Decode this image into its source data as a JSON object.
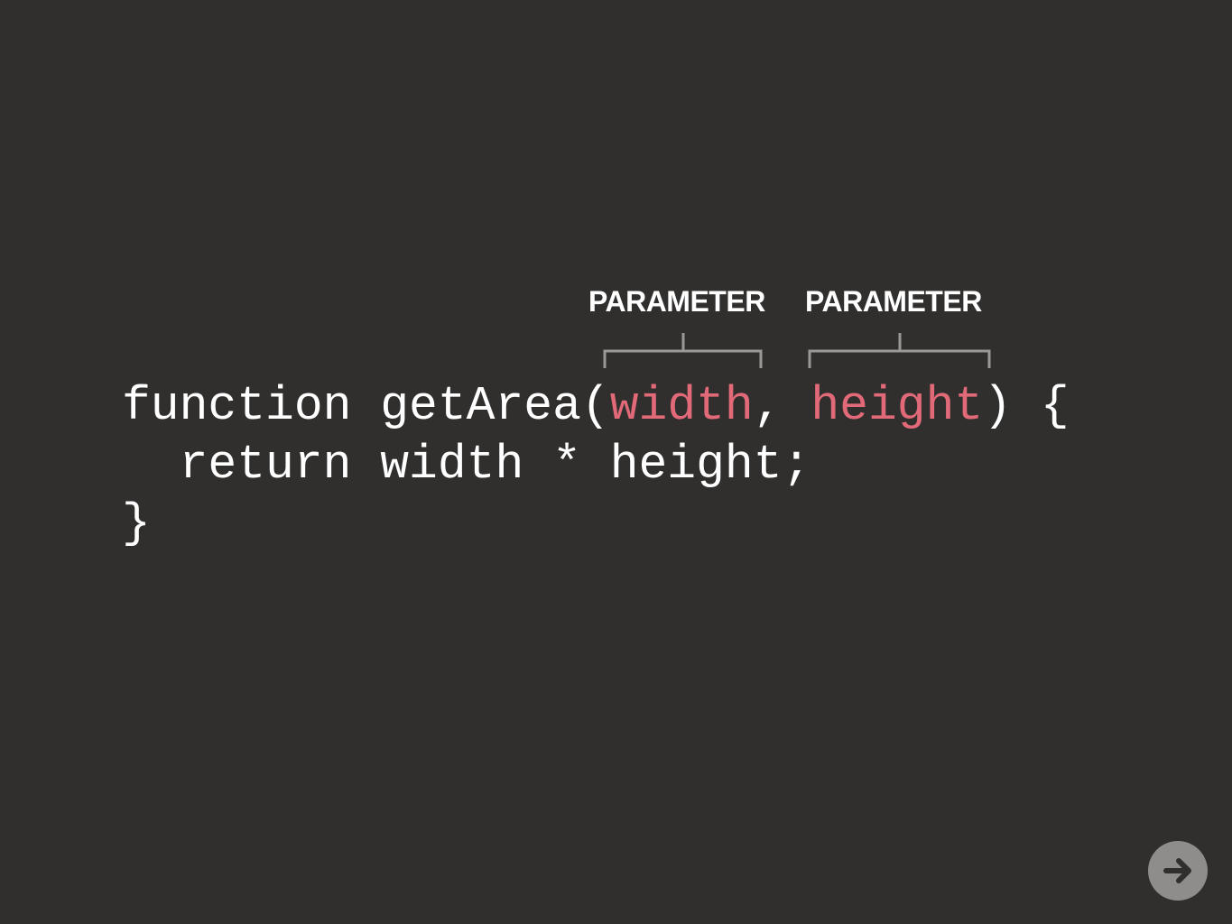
{
  "annotations": {
    "param_label_1": "PARAMETER",
    "param_label_2": "PARAMETER"
  },
  "code": {
    "line1": {
      "prefix": "function getArea(",
      "param1": "width",
      "separator": ", ",
      "param2": "height",
      "suffix": ") {"
    },
    "line2": "  return width * height;",
    "line3": "}"
  },
  "navigation": {
    "next_icon": "arrow-right-icon"
  },
  "colors": {
    "background": "#312f2e",
    "text": "#ffffff",
    "parameter": "#e26a78",
    "bracket": "#9a9998",
    "button": "#8f8d8c",
    "button_icon": "#312f2e"
  }
}
